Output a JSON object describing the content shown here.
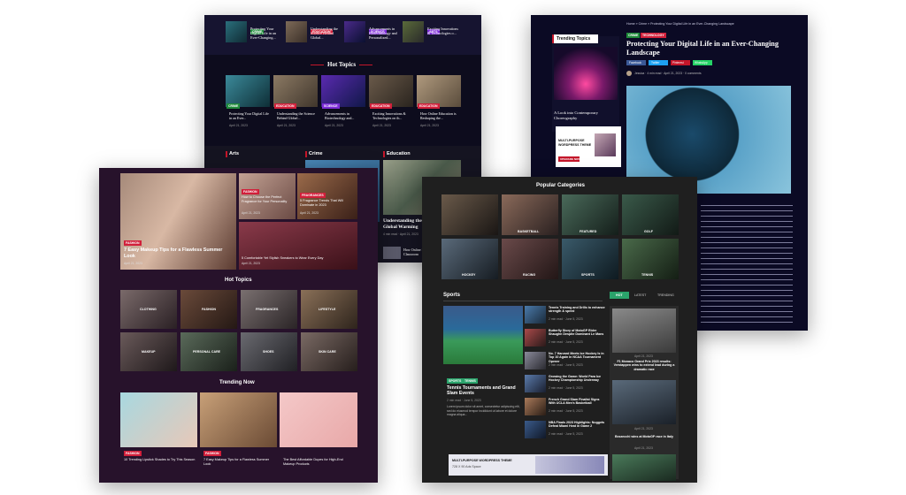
{
  "colors": {
    "crime": "#1f8a3a",
    "education": "#d11f3a",
    "science": "#7c2bd6",
    "arts": "#6a2bd6",
    "fashion": "#d11f3a",
    "sports_accent": "#2aa36b",
    "red": "#c4162a"
  },
  "shotA": {
    "top_items": [
      {
        "tag": "CRIME",
        "title": "Protecting Your Digital Life in an Ever-Changing..."
      },
      {
        "tag": "EDUCATION",
        "title": "Understanding the Science Behind Global..."
      },
      {
        "tag": "SCIENCE",
        "title": "Advancements in Biotechnology and Personalized..."
      },
      {
        "tag": "ARTS",
        "title": "Exciting Innovations & Technologies o..."
      }
    ],
    "hot_topics_heading": "Hot Topics",
    "hot_topics": [
      {
        "tag": "CRIME",
        "title": "Protecting Your Digital Life in an Ever...",
        "date": "April 21, 2023"
      },
      {
        "tag": "EDUCATION",
        "title": "Understanding the Science Behind Global...",
        "date": "April 21, 2023"
      },
      {
        "tag": "SCIENCE",
        "title": "Advancements in Biotechnology and...",
        "date": "April 21, 2023"
      },
      {
        "tag": "EDUCATION",
        "title": "Exciting Innovations & Technologies on th...",
        "date": "April 21, 2023"
      },
      {
        "tag": "EDUCATION",
        "title": "How Online Education is Reshaping the...",
        "date": "April 21, 2023"
      }
    ],
    "sections": [
      "Arts",
      "Crime",
      "Education"
    ],
    "edu_title": "Understanding the Science Behind Global Warming",
    "edu_meta": "4 min read · April 21, 2023",
    "edu_small": "How Online Education is Reshaping the Classroom"
  },
  "shotB": {
    "breadcrumb": "Home » Crime » Protecting Your Digital Life in an Ever-Changing Landscape",
    "trending_label": "Trending Topics",
    "tags": [
      "CRIME",
      "TECHNOLOGY"
    ],
    "title": "Protecting Your Digital Life in an Ever-Changing Landscape",
    "share": [
      "Facebook",
      "Twitter",
      "Pinterest",
      "WhatsApp"
    ],
    "meta": "Jessica · 4 min read · April 21, 2023 · 0 comments",
    "side_caption": "A Look into Contemporary Choreography",
    "ad_lines": [
      "MULTI-PURPOSE",
      "WORDPRESS THEME"
    ],
    "ad_btn": "UPGRADE NOW"
  },
  "shotC": {
    "hero_tag": "FASHION",
    "hero_title": "7 Easy Makeup Tips for a Flawless Summer Look",
    "hero_date": "April 21, 2023",
    "side": [
      {
        "tag": "FASHION",
        "title": "How to Choose the Perfect Fragrance for Your Personality",
        "date": "April 21, 2023"
      },
      {
        "tag": "FRAGRANCES",
        "title": "5 Fragrance Trends That Will Dominate in 2023",
        "date": "April 21, 2023"
      },
      {
        "tag": "",
        "title": "5 Comfortable Yet Stylish Sneakers to Wear Every Day",
        "date": "April 21, 2023"
      }
    ],
    "hot_topics_heading": "Hot Topics",
    "categories": [
      "CLOTHING",
      "FASHION",
      "FRAGRANCES",
      "LIFESTYLE",
      "MAKEUP",
      "PERSONAL CARE",
      "SHOES",
      "SKIN CARE"
    ],
    "trending_heading": "Trending Now",
    "trending": [
      {
        "tag": "FASHION",
        "title": "10 Trending Lipstick Shades to Try This Season"
      },
      {
        "tag": "FASHION",
        "title": "7 Easy Makeup Tips for a Flawless Summer Look"
      },
      {
        "tag": "FASHION",
        "title": "The Best Affordable Dupes for High-End Makeup Products"
      }
    ]
  },
  "shotD": {
    "popular_heading": "Popular Categories",
    "categories": [
      "BASKETBALL",
      "FEATURED",
      "GOLF",
      "HOCKEY",
      "RACING",
      "SPORTS",
      "TENNIS"
    ],
    "sports_heading": "Sports",
    "tabs": [
      "HOT",
      "LATEST",
      "TRENDING"
    ],
    "main_tags": [
      "SPORTS",
      "TENNIS"
    ],
    "main_title": "Tennis Tournaments and Grand Slam Events",
    "main_meta": "2 min read · June 5, 2023",
    "main_excerpt": "Lorem ipsum dolor sit amet, consectetur adipiscing elit, sed do eiusmod tempor incididunt ut labore et dolore magna aliqua...",
    "list": [
      {
        "title": "Tennis Training and Drills to enhance strength & speed",
        "meta": "2 min read · June 5, 2023"
      },
      {
        "title": "Butterfly Story of MotoGP Rider Shaughn Despite Dominant Le Mans",
        "meta": "2 min read · June 5, 2023"
      },
      {
        "title": "No. 7 Harvard Meets Ice Hockey Is in Top 10 Again in NCAA Tournament Opener",
        "meta": "2 min read · June 5, 2023"
      },
      {
        "title": "Growing the Game: World Para Ice Hockey Championship Underway",
        "meta": "2 min read · June 5, 2023"
      },
      {
        "title": "French Grand Slam Finalist Signs With UCLA Men's Basketball",
        "meta": "2 min read · June 5, 2023"
      },
      {
        "title": "NBA Finals 2023 Highlights: Nuggets Defeat Miami Heat in Game 2",
        "meta": "2 min read · June 5, 2023"
      }
    ],
    "right_captions": [
      "April 21, 2023",
      "F1 Monaco Grand Prix 2023 results: Verstappen wins to extend lead during a dramatic race",
      "April 21, 2023",
      "Bezzecchi wins at MotoGP race in Italy",
      "April 21, 2023"
    ],
    "ad_text": "MULTI-PURPOSE WORDPRESS THEME",
    "ad_sub": "728 X 90 Ads Space"
  }
}
